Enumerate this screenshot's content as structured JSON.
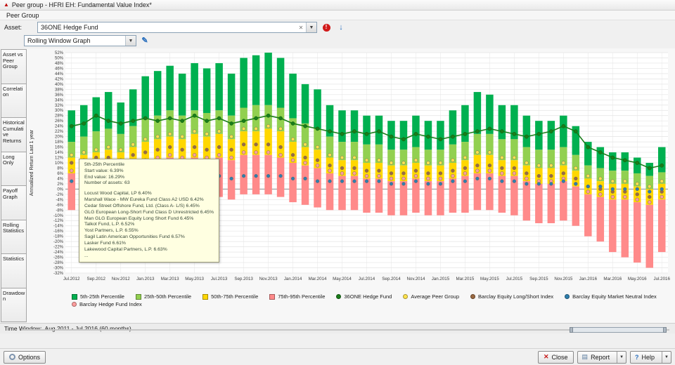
{
  "window": {
    "title": "Peer group - HFRI EH: Fundamental Value Index*"
  },
  "menu": {
    "items": [
      "Peer Group"
    ]
  },
  "toolbar": {
    "asset_label": "Asset:",
    "asset_value": "36ONE Hedge Fund",
    "graph_type": "Rolling Window Graph"
  },
  "sidebar": {
    "tabs": [
      {
        "label": "Asset vs Peer Group"
      },
      {
        "label": "Correlation"
      },
      {
        "label": "Historical Cumulative Returns"
      },
      {
        "label": "Long Only"
      },
      {
        "label": "Payoff Graph"
      },
      {
        "label": "Rolling Statistics"
      },
      {
        "label": "Statistics"
      },
      {
        "label": "Drawdown"
      }
    ]
  },
  "tooltip": {
    "header": [
      "5th-25th Percentile",
      "Start value: 6.39%",
      "End value: 16.29%",
      "Number of assets: 63"
    ],
    "assets": [
      "Locust Wood Capital, LP 6.40%",
      "Marshall Wace - MW Eureka Fund Class A2 USD 6.42%",
      "Cedar Street Offshore Fund, Ltd. (Class A- L/S) 6.45%",
      "GLG European Long-Short Fund Class D Unrestricted 6.45%",
      "Man GLG European Equity Long Short Fund 6.45%",
      "Talkot Fund, L.P. 6.52%",
      "Yost Partners, L.P. 6.55%",
      "Sagil Latin American Opportunities Fund 6.57%",
      "Lasker Fund 6.61%",
      "Lakewood Capital Partners, L.P. 6.63%",
      "..."
    ]
  },
  "legend": {
    "items": [
      {
        "label": "5th-25th Percentile",
        "color": "#00b050",
        "shape": "square"
      },
      {
        "label": "25th-50th Percentile",
        "color": "#92d050",
        "shape": "square"
      },
      {
        "label": "50th-75th Percentile",
        "color": "#ffd700",
        "shape": "square"
      },
      {
        "label": "75th-95th Percentile",
        "color": "#ff8a8a",
        "shape": "square"
      },
      {
        "label": "36ONE Hedge Fund",
        "color": "#1a7d1a",
        "shape": "circle"
      },
      {
        "label": "Average Peer Group",
        "color": "#ffe34d",
        "shape": "circle"
      },
      {
        "label": "Barclay Equity Long/Short Index",
        "color": "#9c6a42",
        "shape": "circle"
      },
      {
        "label": "Barclay Equity Market Neutral Index",
        "color": "#2e7fae",
        "shape": "circle"
      },
      {
        "label": "Barclay Hedge Fund Index",
        "color": "#ff9e9e",
        "shape": "circle"
      }
    ]
  },
  "time_window": {
    "label": "Time Window:",
    "value": "Aug.2011 - Jul.2016 (60 months)"
  },
  "footer": {
    "options_label": "Options",
    "close_label": "Close",
    "report_label": "Report",
    "help_label": "Help"
  },
  "chart_data": {
    "type": "bar",
    "stacked": true,
    "title": "",
    "xlabel": "",
    "ylabel": "Annualized Return Last 1 year",
    "ylim": [
      -32,
      52
    ],
    "ytick_step": 2,
    "xtick_every": 2,
    "grid": true,
    "legend_position": "bottom",
    "x": [
      "Jul.2012",
      "Aug.2012",
      "Sep.2012",
      "Oct.2012",
      "Nov.2012",
      "Dec.2012",
      "Jan.2013",
      "Feb.2013",
      "Mar.2013",
      "Apr.2013",
      "May.2013",
      "Jun.2013",
      "Jul.2013",
      "Aug.2013",
      "Sep.2013",
      "Oct.2013",
      "Nov.2013",
      "Dec.2013",
      "Jan.2014",
      "Feb.2014",
      "Mar.2014",
      "Apr.2014",
      "May.2014",
      "Jun.2014",
      "Jul.2014",
      "Aug.2014",
      "Sep.2014",
      "Oct.2014",
      "Nov.2014",
      "Dec.2014",
      "Jan.2015",
      "Feb.2015",
      "Mar.2015",
      "Apr.2015",
      "May.2015",
      "Jun.2015",
      "Jul.2015",
      "Aug.2015",
      "Sep.2015",
      "Oct.2015",
      "Nov.2015",
      "Dec.2015",
      "Jan.2016",
      "Feb.2016",
      "Mar.2016",
      "Apr.2016",
      "May.2016",
      "Jun.2016",
      "Jul.2016"
    ],
    "series": [
      {
        "key": "p5",
        "name": "5th Percentile (bar top)",
        "values": [
          30,
          32,
          35,
          37,
          33,
          38,
          43,
          45,
          47,
          44,
          48,
          46,
          48,
          44,
          50,
          51,
          52,
          50,
          44,
          40,
          38,
          32,
          30,
          30,
          28,
          28,
          26,
          26,
          28,
          26,
          26,
          30,
          32,
          37,
          36,
          32,
          32,
          28,
          26,
          26,
          28,
          24,
          18,
          16,
          14,
          14,
          12,
          10,
          16
        ]
      },
      {
        "key": "p25",
        "name": "25th Percentile",
        "values": [
          18,
          20,
          22,
          23,
          21,
          24,
          27,
          28,
          30,
          28,
          30,
          29,
          30,
          28,
          31,
          32,
          32,
          31,
          27,
          25,
          23,
          20,
          18,
          18,
          17,
          17,
          15,
          15,
          16,
          15,
          15,
          17,
          18,
          21,
          21,
          19,
          19,
          16,
          15,
          15,
          16,
          13,
          9,
          8,
          7,
          7,
          6,
          5,
          6.4
        ]
      },
      {
        "key": "p50",
        "name": "50th Percentile (median)",
        "values": [
          12,
          13,
          14,
          15,
          14,
          16,
          18,
          19,
          20,
          19,
          21,
          20,
          21,
          19,
          22,
          22,
          23,
          22,
          18,
          16,
          15,
          12,
          11,
          11,
          10,
          10,
          9,
          9,
          10,
          9,
          9,
          10,
          11,
          13,
          13,
          11,
          11,
          9,
          8,
          8,
          9,
          7,
          4,
          3,
          2,
          2,
          1,
          0,
          2
        ]
      },
      {
        "key": "p75",
        "name": "75th Percentile",
        "values": [
          6,
          7,
          8,
          8,
          7,
          9,
          10,
          11,
          12,
          11,
          12,
          11,
          12,
          11,
          13,
          13,
          13,
          12,
          10,
          9,
          8,
          6,
          5,
          5,
          4,
          4,
          3,
          3,
          4,
          3,
          3,
          4,
          5,
          6,
          6,
          5,
          5,
          3,
          2,
          2,
          3,
          1,
          -2,
          -3,
          -4,
          -4,
          -5,
          -6,
          -4
        ]
      },
      {
        "key": "p95",
        "name": "95th Percentile (bar bottom)",
        "values": [
          -8,
          -7,
          -6,
          -6,
          -7,
          -5,
          -4,
          -4,
          -3,
          -4,
          -3,
          -4,
          -3,
          -4,
          -2,
          -2,
          -2,
          -3,
          -5,
          -6,
          -7,
          -8,
          -8,
          -8,
          -9,
          -9,
          -10,
          -10,
          -9,
          -10,
          -10,
          -9,
          -9,
          -8,
          -8,
          -9,
          -10,
          -12,
          -13,
          -13,
          -12,
          -14,
          -18,
          -20,
          -24,
          -26,
          -28,
          -30,
          -24
        ]
      },
      {
        "key": "fund",
        "name": "36ONE Hedge Fund",
        "values": [
          24,
          25,
          28,
          26,
          25,
          26,
          27,
          26,
          27,
          26,
          28,
          26,
          27,
          25,
          26,
          27,
          28,
          27,
          25,
          24,
          23,
          22,
          21,
          22,
          21,
          22,
          20,
          19,
          21,
          20,
          19,
          20,
          21,
          22,
          23,
          22,
          21,
          20,
          21,
          22,
          24,
          22,
          16,
          14,
          12,
          11,
          10,
          8,
          9
        ]
      },
      {
        "key": "avg_peer",
        "name": "Average Peer Group",
        "values": [
          13,
          14,
          15,
          16,
          15,
          17,
          19,
          20,
          21,
          20,
          22,
          21,
          22,
          20,
          23,
          23,
          24,
          23,
          19,
          17,
          16,
          13,
          12,
          12,
          11,
          11,
          10,
          10,
          11,
          10,
          10,
          11,
          12,
          14,
          14,
          12,
          12,
          10,
          9,
          9,
          10,
          8,
          5,
          4,
          3,
          3,
          2,
          1,
          3
        ]
      },
      {
        "key": "barclay_ls",
        "name": "Barclay Equity Long/Short Index",
        "values": [
          10,
          11,
          12,
          12,
          11,
          13,
          14,
          15,
          16,
          15,
          16,
          15,
          16,
          15,
          17,
          17,
          17,
          16,
          13,
          12,
          11,
          9,
          8,
          8,
          7,
          7,
          6,
          6,
          7,
          6,
          6,
          7,
          8,
          9,
          9,
          8,
          8,
          6,
          5,
          5,
          6,
          4,
          1,
          0,
          -1,
          -1,
          -2,
          -3,
          -1
        ]
      },
      {
        "key": "barclay_mn",
        "name": "Barclay Equity Market Neutral Index",
        "values": [
          3,
          3,
          3,
          4,
          3,
          4,
          4,
          4,
          5,
          4,
          5,
          4,
          5,
          4,
          5,
          5,
          5,
          5,
          4,
          4,
          3,
          3,
          3,
          3,
          3,
          3,
          2,
          2,
          3,
          2,
          2,
          3,
          3,
          4,
          4,
          3,
          3,
          2,
          2,
          2,
          3,
          2,
          1,
          1,
          0,
          0,
          0,
          -1,
          0
        ]
      },
      {
        "key": "barclay_hf",
        "name": "Barclay Hedge Fund Index",
        "values": [
          7,
          8,
          9,
          9,
          8,
          10,
          11,
          12,
          13,
          12,
          13,
          12,
          13,
          12,
          14,
          14,
          14,
          13,
          11,
          10,
          9,
          7,
          6,
          6,
          5,
          5,
          4,
          4,
          5,
          4,
          4,
          5,
          6,
          7,
          7,
          6,
          6,
          4,
          3,
          3,
          4,
          2,
          -1,
          -2,
          -3,
          -3,
          -4,
          -5,
          -3
        ]
      }
    ],
    "colors": {
      "band_5_25": "#00b050",
      "band_25_50": "#92d050",
      "band_50_75": "#ffd700",
      "band_75_95": "#ff8a8a",
      "fund_line": "#1a7d1a",
      "avg_peer": "#ffe34d",
      "barclay_ls": "#9c6a42",
      "barclay_mn": "#2e7fae",
      "barclay_hf": "#ff9e9e"
    }
  }
}
